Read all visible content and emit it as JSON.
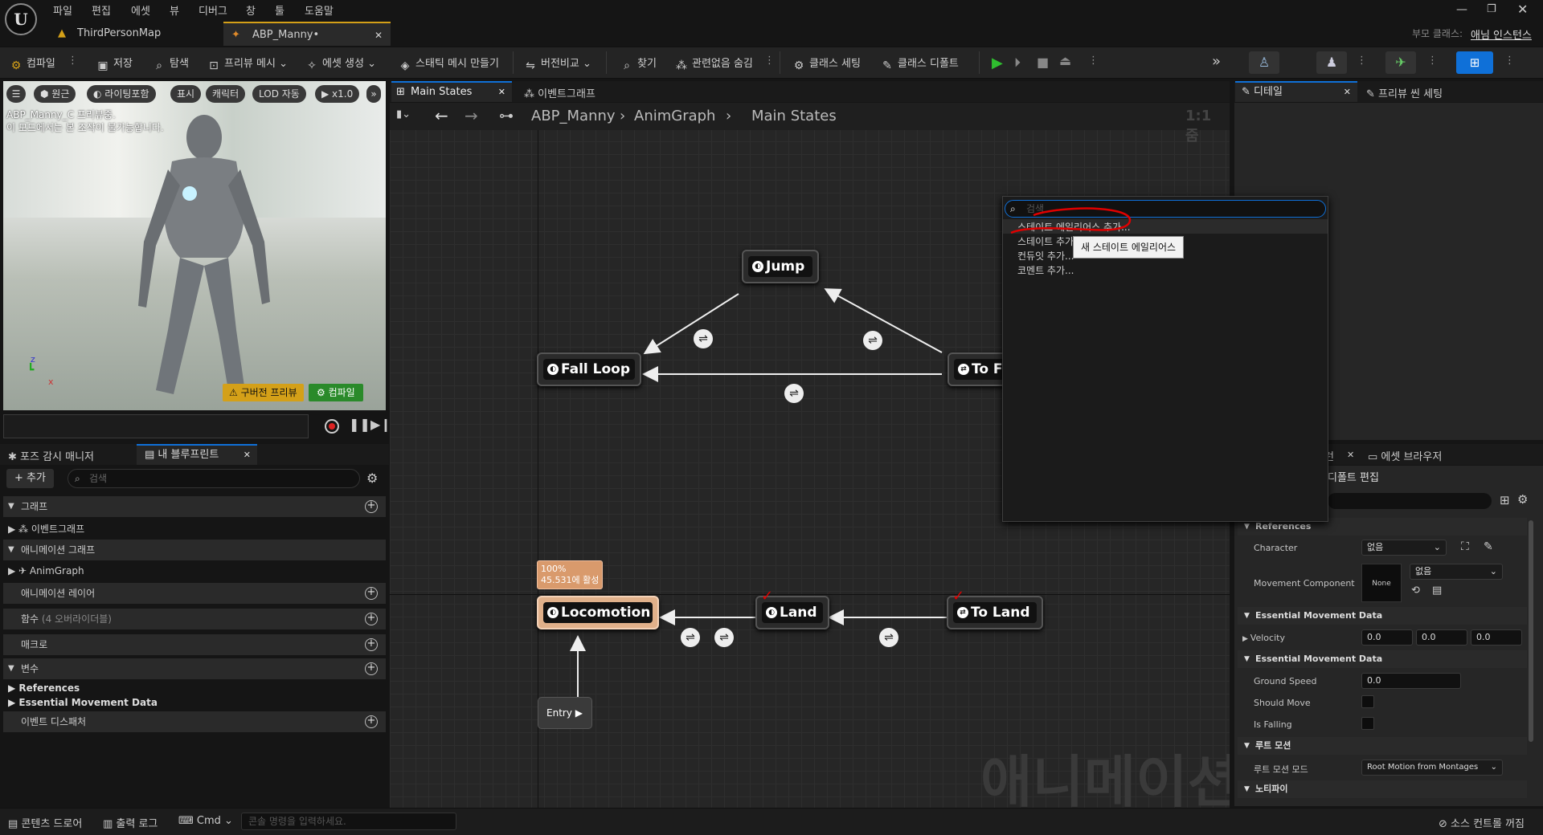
{
  "menu": [
    "파일",
    "편집",
    "에셋",
    "뷰",
    "디버그",
    "창",
    "툴",
    "도움말"
  ],
  "doc_tabs": {
    "map": "ThirdPersonMap",
    "abp": "ABP_Manny•"
  },
  "parent_class": {
    "label": "부모 클래스:",
    "value": "애님 인스턴스"
  },
  "toolbar": {
    "compile": "컴파일",
    "save": "저장",
    "browse": "탐색",
    "preview_mesh": "프리뷰 메시",
    "create_asset": "에셋 생성",
    "make_static_mesh": "스태틱 메시 만들기",
    "diff": "버전비교",
    "find": "찾기",
    "hide_unrelated": "관련없음 숨김",
    "class_settings": "클래스 세팅",
    "class_defaults": "클래스 디폴트"
  },
  "viewport": {
    "perspective": "원근",
    "lighting": "라이팅포함",
    "show": "표시",
    "character": "캐릭터",
    "lod": "LOD 자동",
    "speed": "x1.0",
    "preview_text1": "ABP_Manny_C 프리뷰중.",
    "preview_text2": "이 모드에서는 본 조작이 불가능합니다.",
    "outdated_preview": "구버전 프리뷰",
    "compile_btn": "컴파일"
  },
  "left_tabs": {
    "pose": "포즈 감시 매니저",
    "blueprint": "내 블루프린트"
  },
  "left_panel": {
    "add": "+ 추가",
    "search_placeholder": "검색",
    "graphs": "그래프",
    "event_graph": "이벤트그래프",
    "anim_graphs": "애니메이션 그래프",
    "anim_graph": "AnimGraph",
    "anim_layers": "애니메이션 레이어",
    "functions": "함수",
    "functions_note": "(4 오버라이더블)",
    "macros": "매크로",
    "variables": "변수",
    "references": "References",
    "essential": "Essential Movement Data",
    "event_dispatchers": "이벤트 디스패처"
  },
  "graph_tabs": {
    "main_states": "Main States",
    "event_graph": "이벤트그래프"
  },
  "breadcrumb": {
    "abp": "ABP_Manny",
    "anim": "AnimGraph",
    "states": "Main States",
    "zoom": "1:1 줌"
  },
  "nodes": {
    "jump": "Jump",
    "fall_loop": "Fall Loop",
    "to_fall": "To F",
    "locomotion": "Locomotion",
    "land": "Land",
    "to_land": "To Land",
    "entry": "Entry",
    "weight1": "100%",
    "weight2": "45.531에 활성"
  },
  "watermark": "애니메이션",
  "context_menu": {
    "search_placeholder": "검색",
    "items": [
      "스테이트 에일리어스 추가...",
      "스테이트 추가...",
      "컨듀잇 추가...",
      "코멘트 추가..."
    ],
    "tooltip": "새 스테이트 에일리어스"
  },
  "right_tabs": {
    "details": "디테일",
    "preview_scene": "프리뷰 씬 세팅",
    "asset_browser": "에셋 브라우저",
    "partial_tab": "런",
    "class_defaults_edit": "디폴트 편집"
  },
  "details": {
    "references": "References",
    "character": "Character",
    "character_val": "없음",
    "movement_component": "Movement Component",
    "none": "None",
    "movement_val": "없음",
    "essential1": "Essential Movement Data",
    "velocity": "Velocity",
    "vx": "0.0",
    "vy": "0.0",
    "vz": "0.0",
    "essential2": "Essential Movement Data",
    "ground_speed": "Ground Speed",
    "ground_speed_val": "0.0",
    "should_move": "Should Move",
    "is_falling": "Is Falling",
    "root_motion": "루트 모션",
    "root_motion_mode": "루트 모션 모드",
    "root_motion_val": "Root Motion from Montages",
    "notify": "노티파이"
  },
  "status_bar": {
    "content_drawer": "콘텐츠 드로어",
    "output_log": "출력 로그",
    "cmd": "Cmd",
    "console_placeholder": "콘솔 명령을 입력하세요.",
    "source_control": "소스 컨트롤 꺼짐"
  },
  "colors": {
    "accent_blue": "#0f70d8",
    "compile_green": "#2a8a2a",
    "outdated_yellow": "#d4a018",
    "locomotion": "#e0b08a",
    "annotation_red": "#e00000"
  }
}
